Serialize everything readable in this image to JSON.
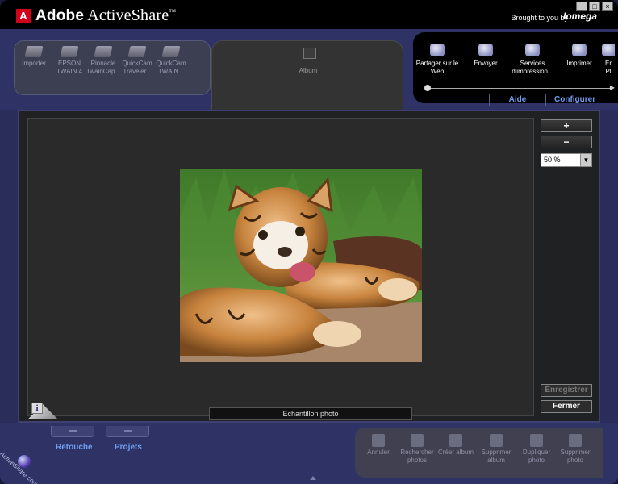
{
  "app": {
    "brand_letter": "A",
    "title_adobe": "Adobe",
    "title_product": "ActiveShare",
    "title_tm": "™",
    "brought_by": "Brought to you by",
    "sponsor": "Iomega",
    "window_buttons": [
      "_",
      "□",
      "×"
    ]
  },
  "sources": [
    {
      "label": "Importer",
      "icon": "import-icon"
    },
    {
      "label": "EPSON TWAIN 4",
      "icon": "scanner-icon"
    },
    {
      "label": "Pinnacle TwainCap...",
      "icon": "scanner-icon"
    },
    {
      "label": "QuickCam Traveler...",
      "icon": "scanner-icon"
    },
    {
      "label": "QuickCam TWAIN...",
      "icon": "scanner-icon"
    }
  ],
  "album": {
    "label": "Album",
    "icon": "album-icon"
  },
  "share": [
    {
      "label": "Partager sur le Web",
      "icon": "web-share-icon"
    },
    {
      "label": "Envoyer",
      "icon": "send-icon"
    },
    {
      "label": "Services d'impression...",
      "icon": "print-services-icon"
    },
    {
      "label": "Imprimer",
      "icon": "printer-icon"
    },
    {
      "label": "Er Pl",
      "icon": "more-icon"
    }
  ],
  "tabs": {
    "aide": "Aide",
    "configurer": "Configurer"
  },
  "viewer": {
    "zoom_in": "+",
    "zoom_out": "−",
    "zoom_value": "50 %",
    "dropdown_arrow": "▼",
    "caption": "Echantillon photo",
    "info": "i",
    "save": "Enregistrer",
    "close": "Fermer"
  },
  "bottom": {
    "retouche": "Retouche",
    "projets": "Projets",
    "logo_text": "ActiveShare.com"
  },
  "tools": [
    {
      "label": "Annuler",
      "icon": "undo-icon"
    },
    {
      "label": "Rechercher photos",
      "icon": "search-photos-icon"
    },
    {
      "label": "Créer album",
      "icon": "create-album-icon"
    },
    {
      "label": "Supprimer album",
      "icon": "delete-album-icon"
    },
    {
      "label": "Dupliquer photo",
      "icon": "duplicate-photo-icon"
    },
    {
      "label": "Supprimer photo",
      "icon": "delete-photo-icon"
    }
  ]
}
